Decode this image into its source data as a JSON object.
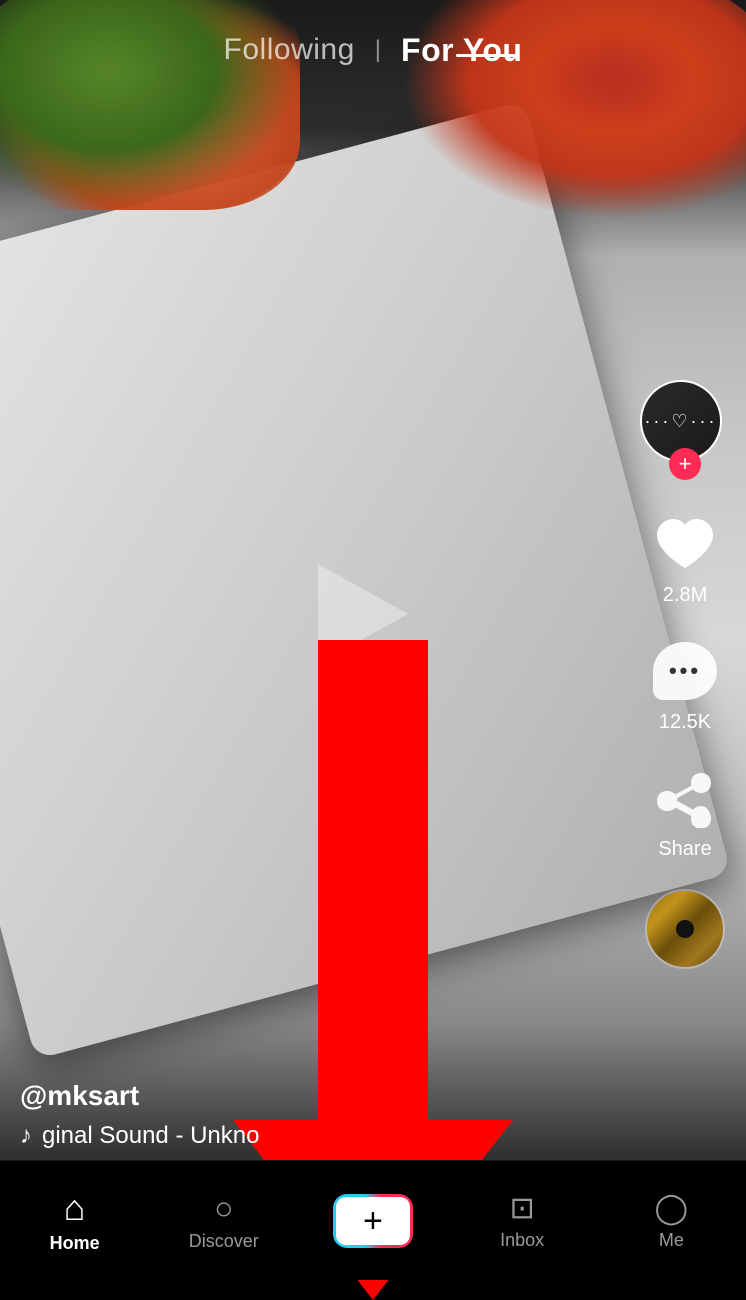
{
  "header": {
    "following_label": "Following",
    "for_you_label": "For You",
    "divider": "|"
  },
  "video": {
    "username": "@mksart",
    "music_info": "ginal Sound - Unkno",
    "music_note": "♪"
  },
  "actions": {
    "likes_count": "2.8M",
    "comments_count": "12.5K",
    "share_label": "Share",
    "add_icon": "+"
  },
  "bottom_nav": {
    "home_label": "Home",
    "discover_label": "Discover",
    "inbox_label": "Inbox",
    "me_label": "Me",
    "create_icon": "+"
  },
  "colors": {
    "active_tab": "#ffffff",
    "inactive_tab": "rgba(255,255,255,0.6)",
    "accent_red": "#fe2c55",
    "accent_cyan": "#29c9f0"
  }
}
